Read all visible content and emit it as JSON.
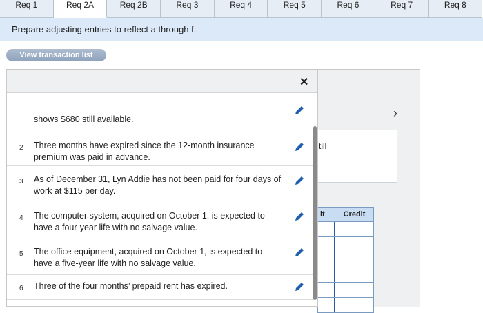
{
  "tabs": [
    "Req 1",
    "Req 2A",
    "Req 2B",
    "Req 3",
    "Req 4",
    "Req 5",
    "Req 6",
    "Req 7",
    "Req 8"
  ],
  "active_tab_index": 1,
  "instruction": "Prepare adjusting entries to reflect a through f.",
  "view_button": "View transaction list",
  "close_symbol": "✕",
  "next_symbol": "›",
  "transactions": [
    {
      "num": "",
      "text": "shows $680 still available."
    },
    {
      "num": "2",
      "text": "Three months have expired since the 12-month insurance premium was paid in advance."
    },
    {
      "num": "3",
      "text": "As of December 31, Lyn Addie has not been paid for four days of work at $115 per day."
    },
    {
      "num": "4",
      "text": "The computer system, acquired on October 1, is expected to have a four-year life with no salvage value."
    },
    {
      "num": "5",
      "text": "The office equipment, acquired on October 1, is expected to have a five-year life with no salvage value."
    },
    {
      "num": "6",
      "text": "Three of the four months’ prepaid rent has expired."
    }
  ],
  "side": {
    "partial_text": "till",
    "debit_partial": "it",
    "credit_label": "Credit"
  },
  "colors": {
    "accent": "#2a5ea8",
    "tab_bg": "#e6edf5",
    "instruction_bg": "#dbe9f8",
    "pencil": "#1f5fae"
  }
}
